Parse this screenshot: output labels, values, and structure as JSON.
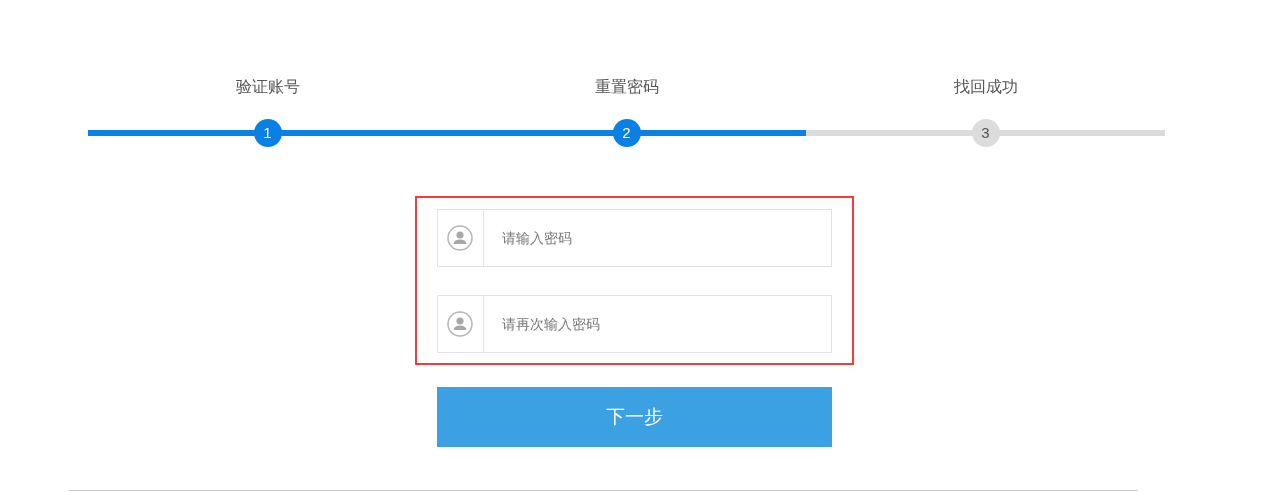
{
  "steps": [
    {
      "label": "验证账号",
      "number": "1",
      "done": true
    },
    {
      "label": "重置密码",
      "number": "2",
      "done": true
    },
    {
      "label": "找回成功",
      "number": "3",
      "done": false
    }
  ],
  "fields": [
    {
      "placeholder": "请输入密码"
    },
    {
      "placeholder": "请再次输入密码"
    }
  ],
  "next_button": "下一步"
}
